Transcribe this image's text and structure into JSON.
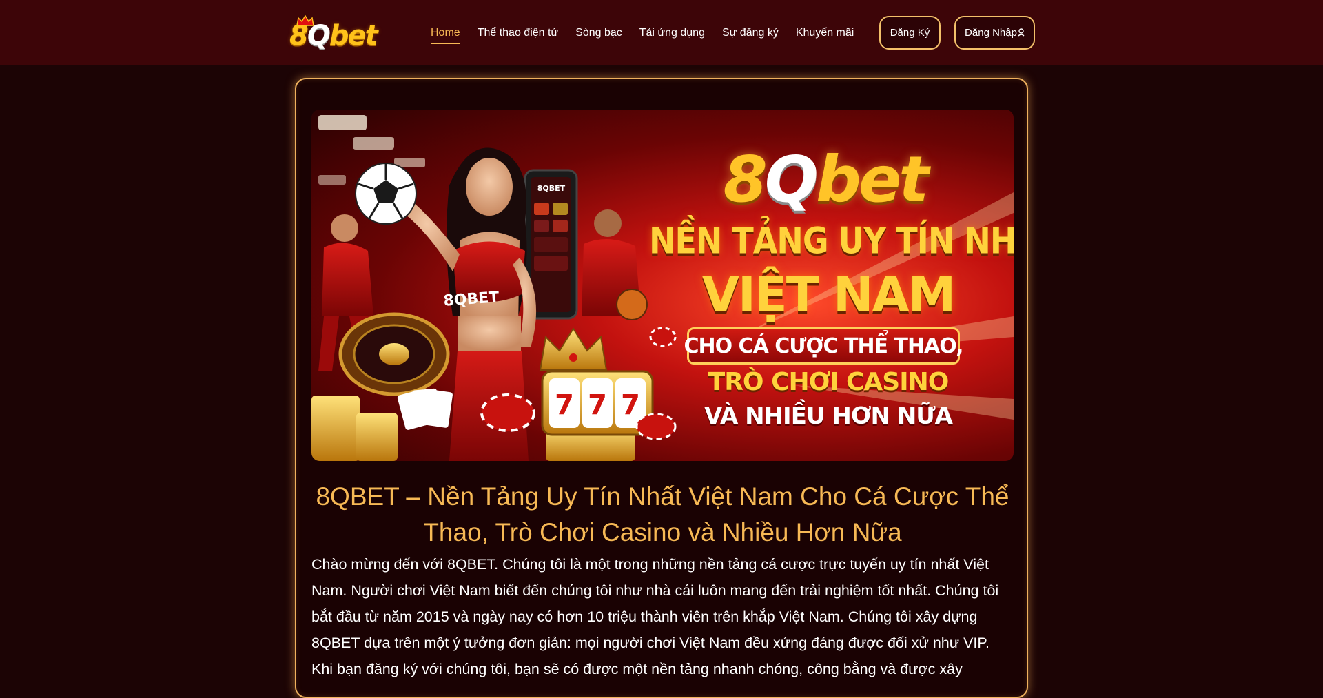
{
  "header": {
    "logo_text_a": "8",
    "logo_text_q": "Q",
    "logo_text_b": "bet",
    "nav": [
      {
        "label": "Home",
        "active": true
      },
      {
        "label": "Thể thao điện tử",
        "active": false
      },
      {
        "label": "Sòng bạc",
        "active": false
      },
      {
        "label": "Tải ứng dụng",
        "active": false
      },
      {
        "label": "Sự đăng ký",
        "active": false
      },
      {
        "label": "Khuyến mãi",
        "active": false
      }
    ],
    "register_label": "Đăng Ký",
    "login_label": "Đăng Nhập",
    "login_icon": "user-icon"
  },
  "banner": {
    "logo_a": "8",
    "logo_q": "Q",
    "logo_b": "bet",
    "line1": "NỀN TẢNG UY TÍN NHẤT",
    "line2": "VIỆT NAM",
    "line3": "CHO CÁ CƯỢC THỂ THAO,",
    "line4": "TRÒ CHƠI CASINO",
    "line5": "VÀ NHIỀU HƠN NỮA",
    "shirt_text": "8QBET",
    "phone_text": "8QBET",
    "slot_digits": "777"
  },
  "content": {
    "title": "8QBET – Nền Tảng Uy Tín Nhất Việt Nam Cho Cá Cược Thể Thao, Trò Chơi Casino và Nhiều Hơn Nữa",
    "intro": "Chào mừng đến với 8QBET. Chúng tôi là một trong những nền tảng cá cược trực tuyến uy tín nhất Việt Nam. Người chơi Việt Nam biết đến chúng tôi như nhà cái luôn mang đến trải nghiệm tốt nhất. Chúng tôi bắt đầu từ năm 2015 và ngày nay có hơn 10 triệu thành viên trên khắp Việt Nam. Chúng tôi xây dựng 8QBET dựa trên một ý tưởng đơn giản: mọi người chơi Việt Nam đều xứng đáng được đối xử như VIP. Khi bạn đăng ký với chúng tôi, bạn sẽ có được một nền tảng nhanh chóng, công bằng và được xây"
  },
  "colors": {
    "header_bg": "#3d0508",
    "page_bg": "#1c0405",
    "accent_gold": "#f7b955",
    "button_border": "#f3c06a"
  }
}
